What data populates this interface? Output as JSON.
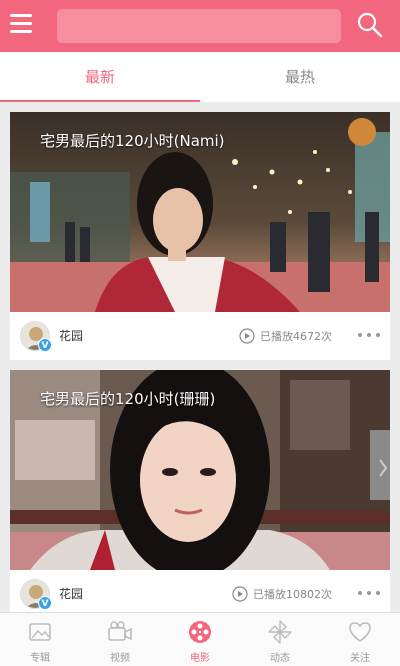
{
  "header": {
    "search_placeholder": ""
  },
  "tabs": [
    {
      "label": "最新",
      "active": true
    },
    {
      "label": "最热",
      "active": false
    }
  ],
  "videos": [
    {
      "title": "宅男最后的120小时(Nami)",
      "author": "花园",
      "plays": "已播放4672次"
    },
    {
      "title": "宅男最后的120小时(珊珊)",
      "author": "花园",
      "plays": "已播放10802次"
    }
  ],
  "nav": [
    {
      "label": "专辑",
      "icon": "album-icon"
    },
    {
      "label": "视频",
      "icon": "video-camera-icon"
    },
    {
      "label": "电影",
      "icon": "film-reel-icon",
      "active": true
    },
    {
      "label": "动态",
      "icon": "pinwheel-icon"
    },
    {
      "label": "关注",
      "icon": "heart-icon"
    }
  ],
  "colors": {
    "accent": "#f2677e"
  }
}
